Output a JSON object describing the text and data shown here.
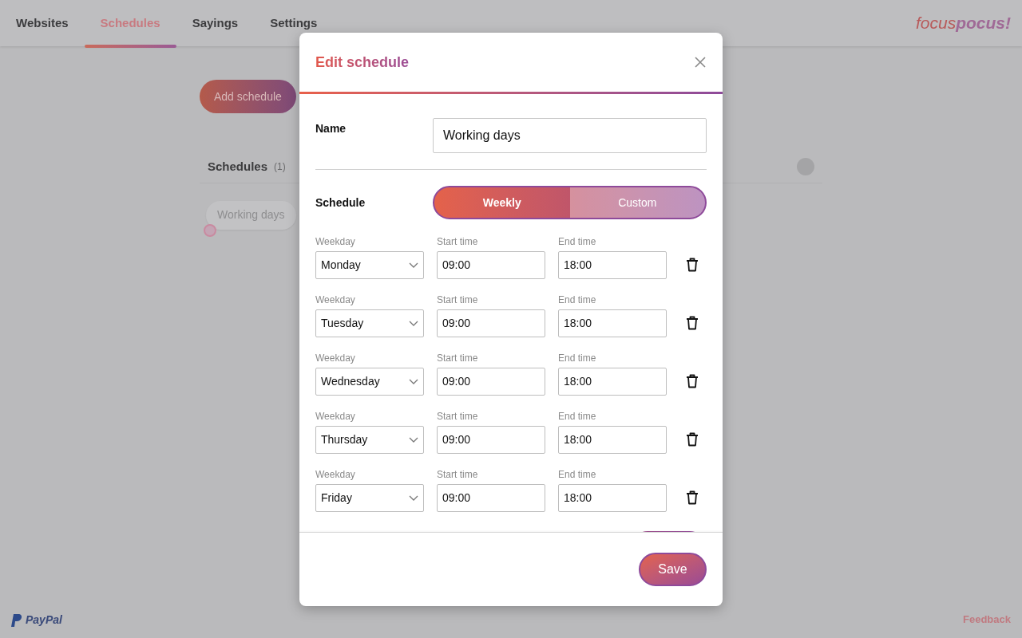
{
  "nav": {
    "tabs": [
      {
        "label": "Websites",
        "selected": false
      },
      {
        "label": "Schedules",
        "selected": true
      },
      {
        "label": "Sayings",
        "selected": false
      },
      {
        "label": "Settings",
        "selected": false
      }
    ],
    "logo": [
      "focus",
      "pocus!"
    ]
  },
  "page": {
    "add_button": "Add schedule",
    "list_title": "Schedules",
    "list_count": "(1)",
    "schedules": [
      "Working days"
    ]
  },
  "footer": {
    "paypal": "PayPal",
    "feedback": "Feedback"
  },
  "dialog": {
    "title": "Edit schedule",
    "name_label": "Name",
    "name_value": "Working days",
    "schedule_label": "Schedule",
    "schedule_options": [
      {
        "label": "Weekly",
        "selected": true
      },
      {
        "label": "Custom",
        "selected": false
      }
    ],
    "rows": [
      {
        "weekday_label": "Weekday",
        "weekday": "Monday",
        "start_label": "Start time",
        "start": "09:00",
        "end_label": "End time",
        "end": "18:00"
      },
      {
        "weekday_label": "Weekday",
        "weekday": "Tuesday",
        "start_label": "Start time",
        "start": "09:00",
        "end_label": "End time",
        "end": "18:00"
      },
      {
        "weekday_label": "Weekday",
        "weekday": "Wednesday",
        "start_label": "Start time",
        "start": "09:00",
        "end_label": "End time",
        "end": "18:00"
      },
      {
        "weekday_label": "Weekday",
        "weekday": "Thursday",
        "start_label": "Start time",
        "start": "09:00",
        "end_label": "End time",
        "end": "18:00"
      },
      {
        "weekday_label": "Weekday",
        "weekday": "Friday",
        "start_label": "Start time",
        "start": "09:00",
        "end_label": "End time",
        "end": "18:00"
      }
    ],
    "save": "Save"
  }
}
